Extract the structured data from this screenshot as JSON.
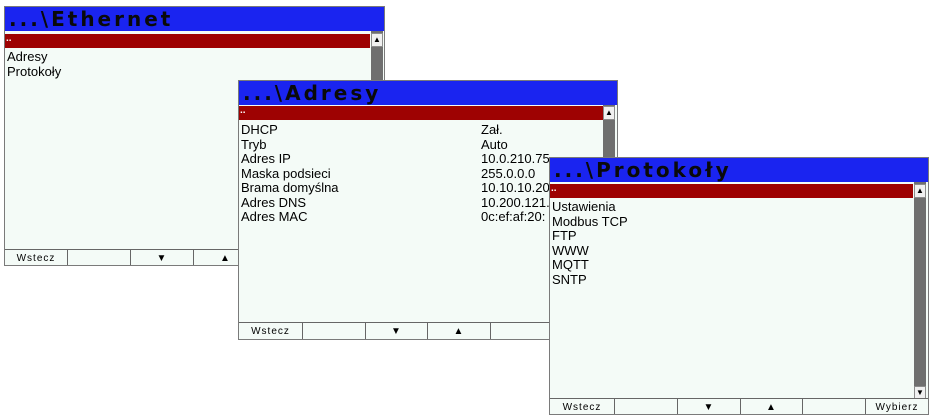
{
  "ethernet": {
    "title": "...\\Ethernet",
    "selected": "..",
    "items": [
      "Adresy",
      "Protokoły"
    ],
    "softkeys": [
      "Wstecz",
      "",
      "▼",
      "▲"
    ],
    "scroll_up": "▲"
  },
  "adresy": {
    "title": "...\\Adresy",
    "selected": "..",
    "rows": [
      {
        "label": "DHCP",
        "value": "Zał."
      },
      {
        "label": "Tryb",
        "value": "Auto"
      },
      {
        "label": "Adres IP",
        "value": "10.0.210.75"
      },
      {
        "label": "Maska podsieci",
        "value": "255.0.0.0"
      },
      {
        "label": "Brama domyślna",
        "value": "10.10.10.20"
      },
      {
        "label": "Adres DNS",
        "value": "10.200.121."
      },
      {
        "label": "Adres MAC",
        "value": "0c:ef:af:20:"
      }
    ],
    "softkeys": [
      "Wstecz",
      "",
      "▼",
      "▲"
    ],
    "scroll_up": "▲"
  },
  "protokoly": {
    "title": "...\\Protokoły",
    "selected": "..",
    "items": [
      "Ustawienia",
      "Modbus TCP",
      "FTP",
      "WWW",
      "MQTT",
      "SNTP"
    ],
    "softkeys": [
      "Wstecz",
      "",
      "▼",
      "▲",
      "",
      "Wybierz"
    ],
    "scroll_up": "▲",
    "scroll_down": "▼"
  }
}
